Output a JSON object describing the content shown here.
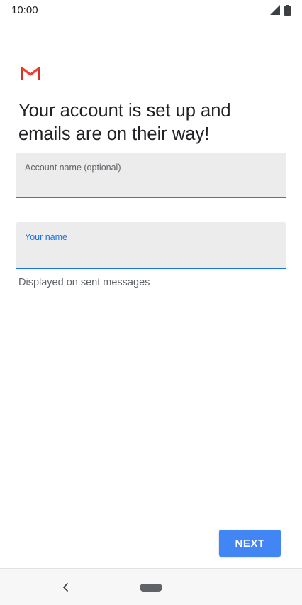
{
  "status_bar": {
    "time": "10:00",
    "icons": [
      "signal-icon",
      "battery-icon"
    ]
  },
  "logo": {
    "icon": "gmail-logo-icon",
    "colors": [
      "#d93025",
      "#ea4335",
      "#c5221f"
    ]
  },
  "heading": "Your account is set up and emails are on their way!",
  "fields": {
    "account_name": {
      "label": "Account name (optional)",
      "value": ""
    },
    "your_name": {
      "label": "Your name",
      "value": "",
      "focused": true
    }
  },
  "helper_text": "Displayed on sent messages",
  "next_button": {
    "label": "NEXT",
    "color": "#4285f4"
  },
  "nav_bar": {
    "icons": [
      "back-icon",
      "home-pill-icon"
    ]
  },
  "colors": {
    "accent": "#1a73e8",
    "field_bg": "#ececec"
  }
}
